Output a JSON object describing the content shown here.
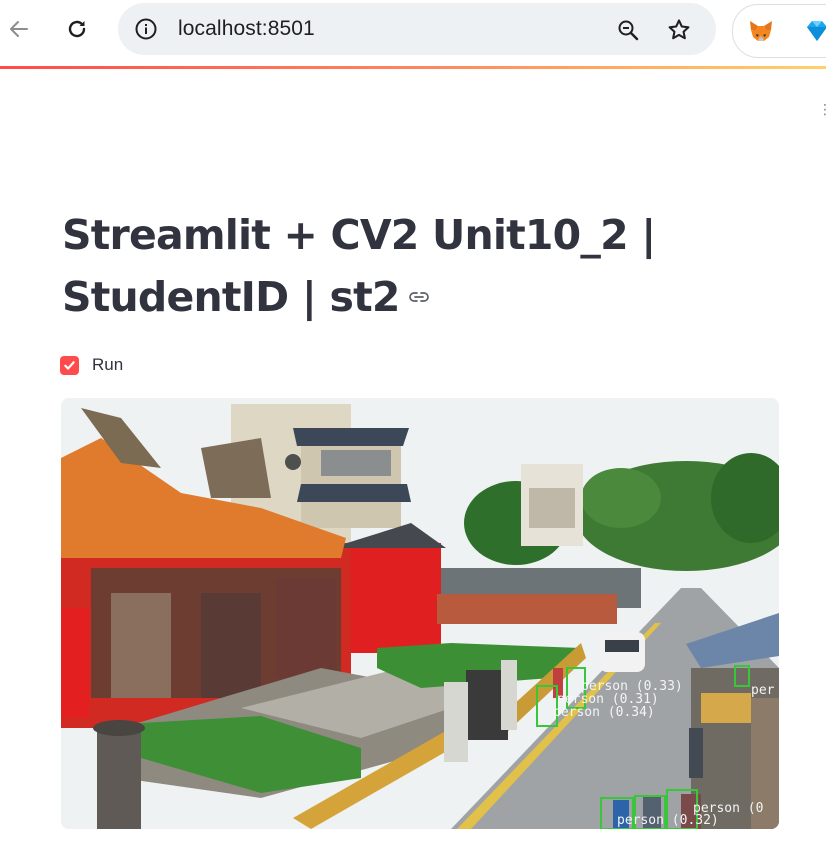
{
  "browser": {
    "url": "localhost:8501",
    "icons": {
      "back": "arrow-left-icon",
      "reload": "reload-icon",
      "site_info": "info-icon",
      "zoom": "zoom-out-icon",
      "bookmark": "star-icon",
      "extension_1": "metamask-fox-icon",
      "extension_2": "blue-diamond-icon"
    }
  },
  "app": {
    "title": "Streamlit + CV2 Unit10_2 | StudentID | st2",
    "run_checkbox": {
      "label": "Run",
      "checked": true
    },
    "accent_color": "#ff4b4b",
    "text_color": "#31333f"
  },
  "video": {
    "detections": [
      {
        "label": "person (0.33)"
      },
      {
        "label": "person (0.31)"
      },
      {
        "label": "person (0.34)"
      },
      {
        "label": "per"
      },
      {
        "label": "person (0"
      },
      {
        "label": "person (0.32)"
      }
    ]
  }
}
